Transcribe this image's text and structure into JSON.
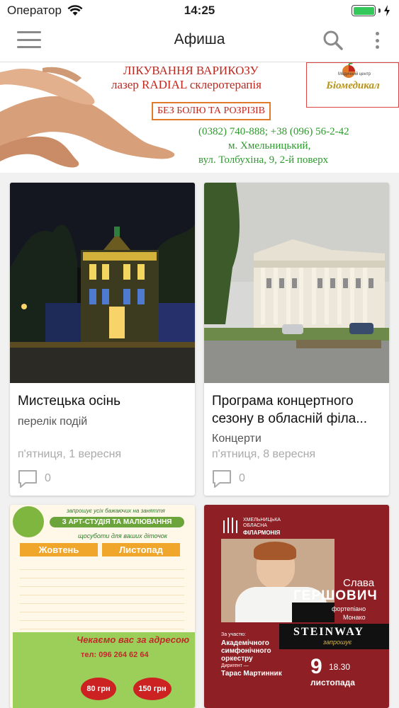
{
  "status_bar": {
    "carrier": "Оператор",
    "time": "14:25"
  },
  "navbar": {
    "title": "Афиша"
  },
  "banner": {
    "line1": "ЛІКУВАННЯ ВАРИКОЗУ",
    "line2": "лазер RADIAL склеротерапія",
    "boxed": "БЕЗ БОЛЮ ТА РОЗРІЗІВ",
    "phones": "(0382) 740-888; +38 (096) 56-2-42",
    "city": "м. Хмельницький,",
    "address": "вул. Толбухіна, 9, 2-й поверх",
    "logo_top": "Медичний центр",
    "logo_name": "Біомедикал"
  },
  "events": [
    {
      "title": "Мистецька осінь",
      "category": "перелік подій",
      "date": "п'ятниця, 1 вересня",
      "comments": "0"
    },
    {
      "title": "Програма концертного сезону в обласній філа...",
      "category": "Концерти",
      "date": "п'ятниця, 8 вересня",
      "comments": "0"
    }
  ],
  "poster_studio": {
    "top": "запрошує усіх бажаючих на заняття",
    "title": "З АРТ-СТУДІЯ ТА МАЛЮВАННЯ",
    "subtitle": "щосуботи для ваших діточок",
    "month1": "Жовтень",
    "month2": "Листопад",
    "wait": "Чекаємо вас за адресою",
    "phone": "тел: 096 264 62 64",
    "price1": "80 грн",
    "price2": "150 грн"
  },
  "poster_concert": {
    "org1": "ХМЕЛЬНИЦЬКА",
    "org2": "ОБЛАСНА",
    "org3": "ФІЛАРМОНІЯ",
    "performer_first": "Слава",
    "performer_last": "ГЕРШОВИЧ",
    "instrument": "фортепіано",
    "city": "Монако",
    "brand": "STEINWAY",
    "brand_sub": "запрошує",
    "with": "За участю:",
    "orchestra": "Академічного симфонічного оркестру",
    "conductor_label": "Диригент —",
    "conductor": "Тарас Мартинник",
    "day": "9",
    "time": "18.30",
    "month": "листопада"
  },
  "colors": {
    "accent_green": "#2d9a2d",
    "banner_red": "#c0281e",
    "poster_red": "#8e1f24",
    "nav_icon": "#8a8a8a"
  }
}
